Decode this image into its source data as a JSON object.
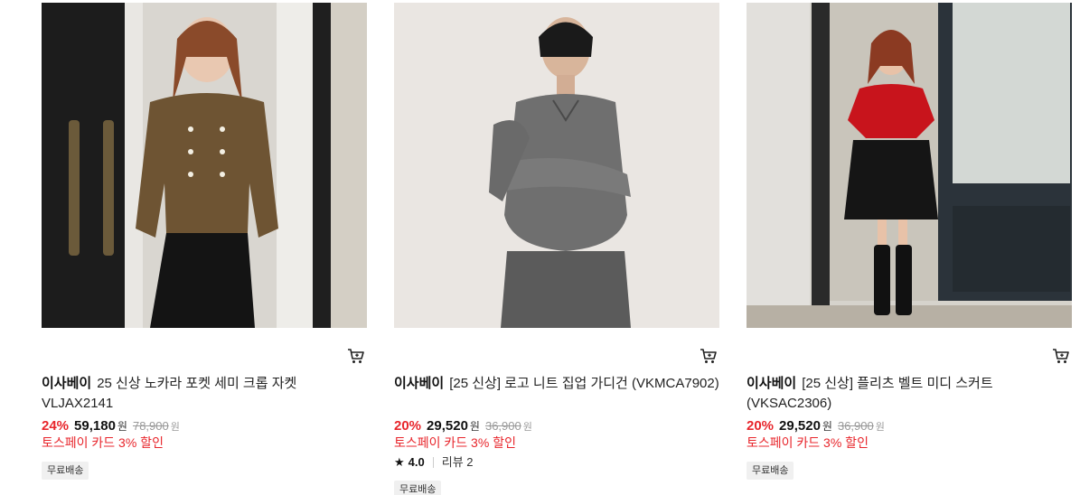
{
  "products": [
    {
      "brand": "이사베이",
      "title": "25 신상 노카라 포켓 세미 크롭 자켓 VLJAX2141",
      "discount_rate": "24%",
      "price": "59,180",
      "currency": "원",
      "original_price": "78,900",
      "original_currency": "원",
      "promo": "토스페이 카드 3% 할인",
      "badge": "무료배송",
      "image_icon": "product-photo-tweed-jacket",
      "cart_icon": "cart-icon"
    },
    {
      "brand": "이사베이",
      "title": "[25 신상] 로고 니트 집업 가디건 (VKMCA7902)",
      "discount_rate": "20%",
      "price": "29,520",
      "currency": "원",
      "original_price": "36,900",
      "original_currency": "원",
      "promo": "토스페이 카드 3% 할인",
      "rating": "4.0",
      "review_text": "리뷰 2",
      "badge": "무료배송",
      "image_icon": "product-photo-knit-cardigan",
      "cart_icon": "cart-icon"
    },
    {
      "brand": "이사베이",
      "title": "[25 신상] 플리츠 벨트 미디 스커트 (VKSAC2306)",
      "discount_rate": "20%",
      "price": "29,520",
      "currency": "원",
      "original_price": "36,900",
      "original_currency": "원",
      "promo": "토스페이 카드 3% 할인",
      "badge": "무료배송",
      "image_icon": "product-photo-pleated-skirt",
      "cart_icon": "cart-icon"
    }
  ],
  "colors": {
    "discount_red": "#e8262c",
    "badge_bg": "#f0f0f0"
  }
}
